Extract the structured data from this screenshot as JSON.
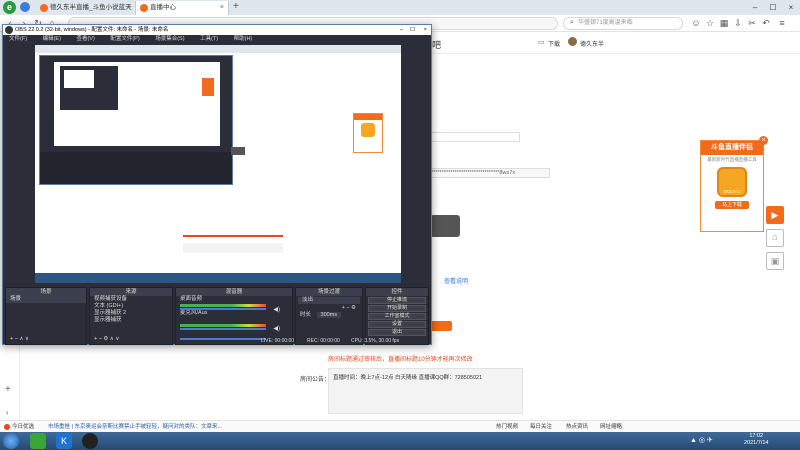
{
  "tabs": [
    {
      "label": "德久东半直播_斗鱼小说蓝天",
      "color": "#f26a1b"
    },
    {
      "label": "直播中心",
      "color": "#f26a1b"
    }
  ],
  "search": {
    "placeholder": "华盛顿71度高温来临"
  },
  "header": {
    "download_label": "下载",
    "user_name": "德久东半",
    "page_fragment": "吧"
  },
  "obs": {
    "title": "OBS 22.0.2 (32-bit, windows) - 配置文件: 未命名 - 场景: 未命名",
    "menu": [
      "文件(F)",
      "编辑(E)",
      "查看(V)",
      "配置文件(P)",
      "场景集合(S)",
      "工具(T)",
      "帮助(H)"
    ],
    "scenes_title": "场景",
    "scene_item": "场景",
    "sources_title": "来源",
    "sources": [
      "视频捕获设备",
      "文本 (GDI+)",
      "显示器捕获 2",
      "显示器捕获"
    ],
    "mixer_title": "混音器",
    "mixer": [
      {
        "name": "桌面音频",
        "db": "0.0 dB"
      },
      {
        "name": "麦克风/Aux",
        "db": "0.0 dB"
      },
      {
        "name": "视频捕获设备",
        "db": "0.0 dB"
      }
    ],
    "transitions_title": "场景过渡",
    "transition_value": "淡出",
    "duration_label": "时长",
    "duration_value": "300ms",
    "controls_title": "控件",
    "controls": [
      "停止推流",
      "开始录制",
      "工作室模式",
      "设置",
      "退出"
    ],
    "status_live": "LIVE: 00:00:00",
    "status_rec": "REC: 00:00:00",
    "status_cpu": "CPU: 3.5%, 30.00 fps"
  },
  "page": {
    "stream_key_suffix": "********************************8ws7x",
    "link_text": "查看说明",
    "notice_text": "房间标题通过审核后，直播间标题10分钟才能再次修改",
    "announce_label": "房间公告：",
    "announce_text": "直播时间：晚上7点-12点 白天随缘 直播课QQ群：728505021"
  },
  "ad": {
    "title": "斗鱼直播伴侣",
    "subtitle": "最新新时代直播直播工具",
    "logo": "DOUYU",
    "button": "马上下载"
  },
  "statusbar": {
    "left": "今日优选",
    "news": "市场重挫 | 东京奥运会奈斯比赛禁止手被轻轻，疑问对的类队：文章来...",
    "items": [
      "热门视频",
      "每日关注",
      "热点资讯",
      "网址缩略"
    ]
  },
  "taskbar": {
    "time": "17:02",
    "date": "2021/7/14"
  },
  "colors": {
    "accent": "#f26a1b",
    "obs_bg": "#2b2e38",
    "taskbar": "#2d5683"
  }
}
